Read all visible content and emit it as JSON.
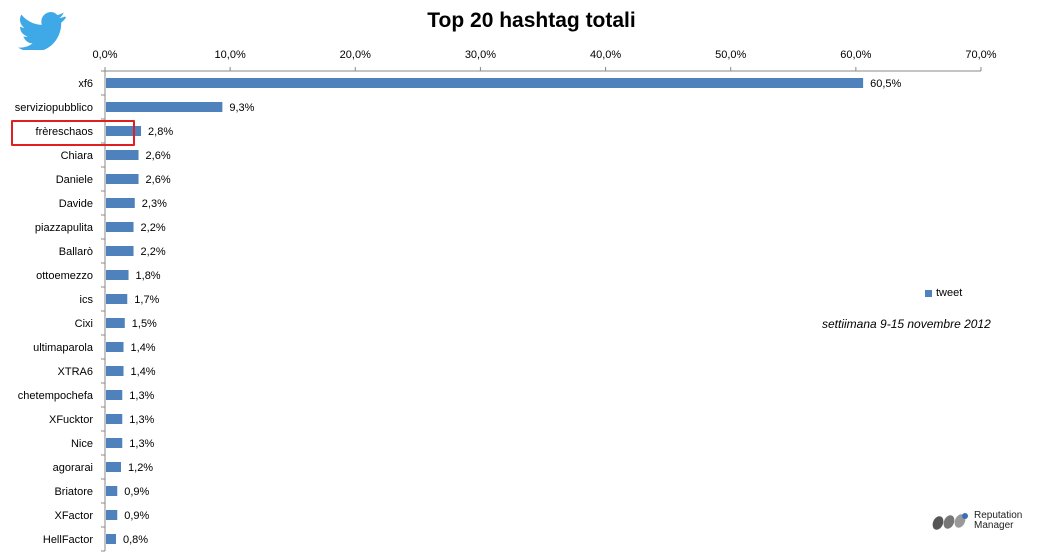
{
  "chart_data": {
    "type": "bar",
    "orientation": "horizontal",
    "title": "Top 20 hashtag totali",
    "categories": [
      "xf6",
      "serviziopubblico",
      "frèreschaos",
      "Chiara",
      "Daniele",
      "Davide",
      "piazzapulita",
      "Ballarò",
      "ottoemezzo",
      "ics",
      "Cixi",
      "ultimaparola",
      "XTRA6",
      "chetempochefa",
      "XFucktor",
      "Nice",
      "agorarai",
      "Briatore",
      "XFactor",
      "HellFactor"
    ],
    "series": [
      {
        "name": "tweet",
        "values": [
          60.5,
          9.3,
          2.8,
          2.6,
          2.6,
          2.3,
          2.2,
          2.2,
          1.8,
          1.7,
          1.5,
          1.4,
          1.4,
          1.3,
          1.3,
          1.3,
          1.2,
          0.9,
          0.9,
          0.8
        ],
        "labels": [
          "60,5%",
          "9,3%",
          "2,8%",
          "2,6%",
          "2,6%",
          "2,3%",
          "2,2%",
          "2,2%",
          "1,8%",
          "1,7%",
          "1,5%",
          "1,4%",
          "1,4%",
          "1,3%",
          "1,3%",
          "1,3%",
          "1,2%",
          "0,9%",
          "0,9%",
          "0,8%"
        ]
      }
    ],
    "x_ticks": [
      "0,0%",
      "10,0%",
      "20,0%",
      "30,0%",
      "40,0%",
      "50,0%",
      "60,0%",
      "70,0%"
    ],
    "xlim": [
      0,
      70
    ],
    "axis_position": "top",
    "grid": false,
    "legend_position": "right",
    "bar_color": "#4f81bd",
    "annotation": "settiimana 9-15 novembre 2012",
    "highlighted_category": "frèreschaos",
    "highlight_color": "#e02020"
  },
  "brand": {
    "line1": "Reputation",
    "line2": "Manager"
  },
  "icons": {
    "corner": "twitter-bird-icon",
    "brand": "reputation-manager-logo-icon"
  }
}
